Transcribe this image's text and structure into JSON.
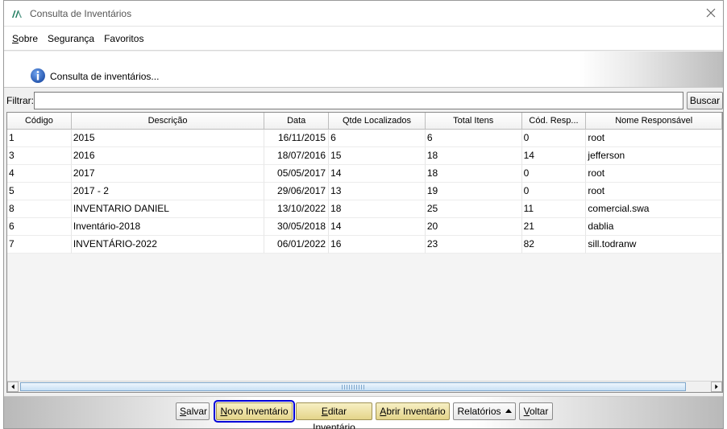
{
  "window": {
    "title": "Consulta de Inventários"
  },
  "menu": [
    {
      "mnemonic": "S",
      "rest": "obre"
    },
    {
      "mnemonic": "",
      "rest": "Segurança"
    },
    {
      "mnemonic": "",
      "rest": "Favoritos"
    }
  ],
  "info": {
    "text": "Consulta de inventários..."
  },
  "filter": {
    "label": "Filtrar:",
    "value": "",
    "placeholder": "",
    "button": "Buscar"
  },
  "table": {
    "columns": [
      "Código",
      "Descrição",
      "Data",
      "Qtde Localizados",
      "Total Itens",
      "Cód. Resp...",
      "Nome Responsável"
    ],
    "rows": [
      [
        "1",
        "2015",
        "16/11/2015",
        "6",
        "6",
        "0",
        "root"
      ],
      [
        "3",
        "2016",
        "18/07/2016",
        "15",
        "18",
        "14",
        "jefferson"
      ],
      [
        "4",
        "2017",
        "05/05/2017",
        "14",
        "18",
        "0",
        "root"
      ],
      [
        "5",
        "2017 - 2",
        "29/06/2017",
        "13",
        "19",
        "0",
        "root"
      ],
      [
        "8",
        "INVENTARIO DANIEL",
        "13/10/2022",
        "18",
        "25",
        "11",
        "comercial.swa"
      ],
      [
        "6",
        "Inventário-2018",
        "30/05/2018",
        "14",
        "20",
        "21",
        "dablia"
      ],
      [
        "7",
        "INVENTÁRIO-2022",
        "06/01/2022",
        "16",
        "23",
        "82",
        "sill.todranw"
      ]
    ]
  },
  "buttons": {
    "salvar": {
      "mn": "S",
      "rest": "alvar"
    },
    "novo": {
      "mn": "N",
      "rest": "ovo Inventário"
    },
    "editar": {
      "mn": "E",
      "rest": "ditar Inventário"
    },
    "abrir": {
      "mn": "A",
      "rest": "brir Inventário"
    },
    "relatorios": {
      "label": "Relatórios"
    },
    "voltar": {
      "mn": "V",
      "rest": "oltar"
    }
  },
  "colors": {
    "focus": "#0000d8",
    "gold_button": "#e4d48a",
    "info_blue": "#1f5fbf"
  },
  "icons": {
    "app": "app-logo-icon",
    "close": "close-icon",
    "info": "info-icon",
    "relatorios_menu": "triangle-up-icon"
  }
}
